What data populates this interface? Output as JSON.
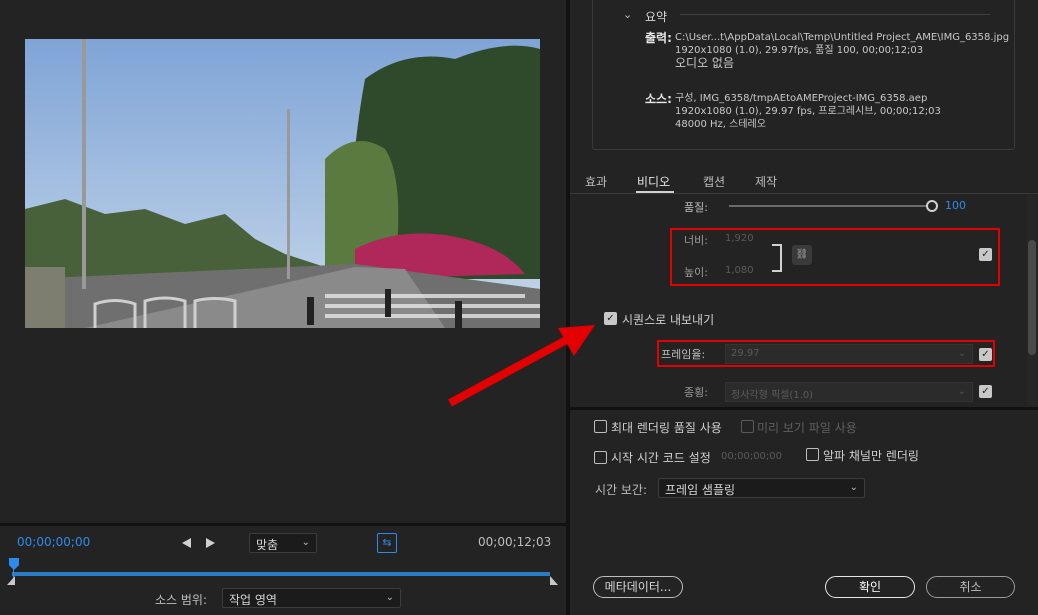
{
  "preview": {
    "timecode_start": "00;00;00;00",
    "timecode_end": "00;00;12;03",
    "fit_select": "맞춤",
    "source_range_label": "소스 범위:",
    "source_range_value": "작업 영역"
  },
  "summary": {
    "title": "요약",
    "output_label": "출력:",
    "output_line1": "C:\\User...t\\AppData\\Local\\Temp\\Untitled Project_AME\\IMG_6358.jpg",
    "output_line2": "1920x1080 (1.0), 29.97fps, 품질 100, 00;00;12;03",
    "output_line3": "오디오 없음",
    "source_label": "소스:",
    "source_line1": "구성, IMG_6358/tmpAEtoAMEProject-IMG_6358.aep",
    "source_line2": "1920x1080 (1.0), 29.97 fps, 프로그레시브, 00;00;12;03",
    "source_line3": "48000 Hz, 스테레오"
  },
  "tabs": {
    "effects": "효과",
    "video": "비디오",
    "captions": "캡션",
    "publish": "제작"
  },
  "video": {
    "quality_label": "품질:",
    "quality_value": "100",
    "quality_level": 1.0,
    "width_label": "너비:",
    "width_value": "1,920",
    "height_label": "높이:",
    "height_value": "1,080",
    "export_as_sequence": "시퀀스로 내보내기",
    "frame_rate_label": "프레임율:",
    "frame_rate_value": "29.97",
    "aspect_label": "종횡:",
    "aspect_value": "정사각형 픽셀(1.0)"
  },
  "options": {
    "max_render": "최대 렌더링 품질 사용",
    "use_previews": "미리 보기 파일 사용",
    "set_start_tc": "시작 시간 코드 설정",
    "start_tc_value": "00;00;00;00",
    "alpha_only": "알파 채널만 렌더링",
    "interp_label": "시간 보간:",
    "interp_value": "프레임 샘플링"
  },
  "buttons": {
    "metadata": "메타데이터...",
    "ok": "확인",
    "cancel": "취소"
  },
  "colors": {
    "accent": "#2d8ceb",
    "highlight_box": "#e30000"
  }
}
